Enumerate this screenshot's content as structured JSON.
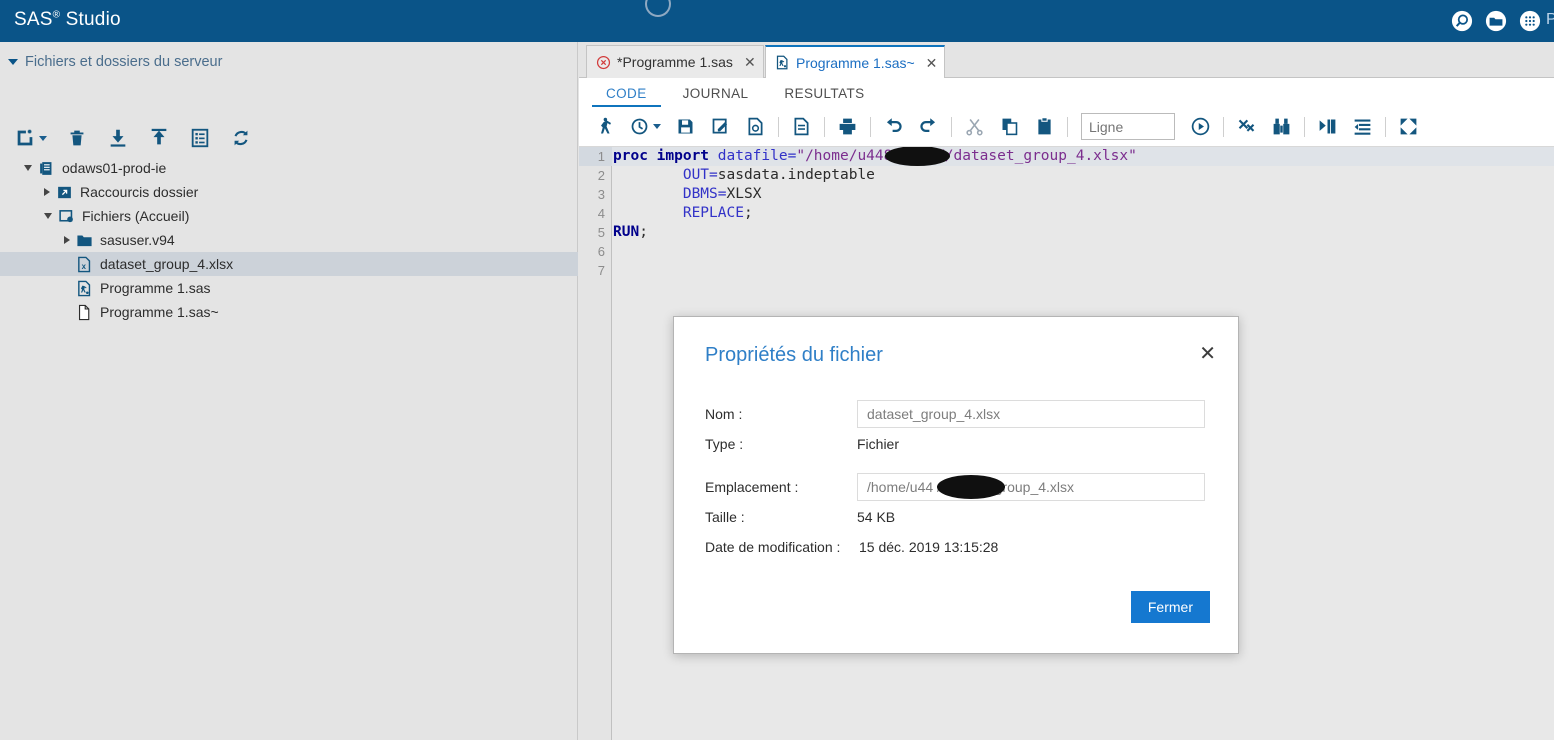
{
  "app": {
    "brand_name": "SAS",
    "brand_sup": "®",
    "brand_suffix": " Studio",
    "user_menu": "P",
    "header_icons": [
      "search-icon",
      "folder-icon",
      "apps-grid-icon"
    ],
    "accent_blue": "#0a5488",
    "link_blue": "#2f7fc7",
    "button_blue": "#1578d0"
  },
  "file_panel": {
    "title": "Fichiers et dossiers du serveur",
    "toolbar": [
      {
        "name": "new-file-button",
        "has_dropdown": true
      },
      {
        "name": "delete-button",
        "has_dropdown": false
      },
      {
        "name": "download-button",
        "has_dropdown": false
      },
      {
        "name": "upload-button",
        "has_dropdown": false
      },
      {
        "name": "properties-button",
        "has_dropdown": false
      },
      {
        "name": "refresh-button",
        "has_dropdown": false
      }
    ],
    "tree": [
      {
        "label": "odaws01-prod-ie",
        "indent": 0,
        "state": "open",
        "icon": "server-icon",
        "selected": false
      },
      {
        "label": "Raccourcis dossier",
        "indent": 1,
        "state": "closed",
        "icon": "shortcut-icon",
        "selected": false
      },
      {
        "label": "Fichiers (Accueil)",
        "indent": 1,
        "state": "open",
        "icon": "home-files-icon",
        "selected": false
      },
      {
        "label": "sasuser.v94",
        "indent": 2,
        "state": "closed",
        "icon": "folder-icon",
        "selected": false
      },
      {
        "label": "dataset_group_4.xlsx",
        "indent": 2,
        "state": "leaf",
        "icon": "excel-file-icon",
        "selected": true
      },
      {
        "label": "Programme 1.sas",
        "indent": 2,
        "state": "leaf",
        "icon": "sas-file-icon",
        "selected": false
      },
      {
        "label": "Programme 1.sas~",
        "indent": 2,
        "state": "leaf",
        "icon": "plain-file-icon",
        "selected": false
      }
    ]
  },
  "editor": {
    "tabs": [
      {
        "label": "*Programme 1.sas",
        "icon": "error-circle-icon",
        "active": false
      },
      {
        "label": "Programme 1.sas~",
        "icon": "sas-file-icon",
        "active": true
      }
    ],
    "subtabs": [
      {
        "label": "CODE",
        "active": true
      },
      {
        "label": "JOURNAL",
        "active": false
      },
      {
        "label": "RESULTATS",
        "active": false
      }
    ],
    "toolbar": [
      {
        "name": "run-button",
        "type": "icon"
      },
      {
        "name": "history-button",
        "type": "icon-dropdown"
      },
      {
        "name": "save-button",
        "type": "icon"
      },
      {
        "name": "save-as-button",
        "type": "icon"
      },
      {
        "name": "print-preview-button",
        "type": "icon"
      },
      {
        "name": "sep",
        "type": "sep"
      },
      {
        "name": "properties-button",
        "type": "icon"
      },
      {
        "name": "sep",
        "type": "sep"
      },
      {
        "name": "print-button",
        "type": "icon"
      },
      {
        "name": "sep",
        "type": "sep"
      },
      {
        "name": "undo-button",
        "type": "icon"
      },
      {
        "name": "redo-button",
        "type": "icon"
      },
      {
        "name": "sep",
        "type": "sep"
      },
      {
        "name": "cut-button",
        "type": "icon"
      },
      {
        "name": "copy-button",
        "type": "icon"
      },
      {
        "name": "paste-button",
        "type": "icon"
      },
      {
        "name": "sep",
        "type": "sep"
      },
      {
        "name": "line-input",
        "type": "input"
      },
      {
        "name": "goto-line-button",
        "type": "icon"
      },
      {
        "name": "sep",
        "type": "sep"
      },
      {
        "name": "clear-all-button",
        "type": "icon"
      },
      {
        "name": "find-replace-button",
        "type": "icon"
      },
      {
        "name": "sep",
        "type": "sep"
      },
      {
        "name": "indent-button",
        "type": "icon"
      },
      {
        "name": "outdent-button",
        "type": "icon"
      },
      {
        "name": "sep",
        "type": "sep"
      },
      {
        "name": "maximize-button",
        "type": "icon"
      }
    ],
    "line_placeholder": "Ligne",
    "line_value": "",
    "code_lines": [
      {
        "number": "1",
        "current": true,
        "tokens": [
          {
            "t": "proc import",
            "c": "kw"
          },
          {
            "t": " ",
            "c": "pln"
          },
          {
            "t": "datafile=",
            "c": "opt"
          },
          {
            "t": "\"/home/u448",
            "c": "str"
          },
          {
            "t": "XXXXXX",
            "c": "str"
          },
          {
            "t": "/dataset_group_4.xlsx\"",
            "c": "str"
          }
        ]
      },
      {
        "number": "2",
        "current": false,
        "tokens": [
          {
            "t": "        ",
            "c": "pln"
          },
          {
            "t": "OUT=",
            "c": "opt"
          },
          {
            "t": "sasdata.indeptable",
            "c": "pln"
          }
        ]
      },
      {
        "number": "3",
        "current": false,
        "tokens": [
          {
            "t": "        ",
            "c": "pln"
          },
          {
            "t": "DBMS=",
            "c": "opt"
          },
          {
            "t": "XLSX",
            "c": "pln"
          }
        ]
      },
      {
        "number": "4",
        "current": false,
        "tokens": [
          {
            "t": "        ",
            "c": "pln"
          },
          {
            "t": "REPLACE",
            "c": "opt"
          },
          {
            "t": ";",
            "c": "punc"
          }
        ]
      },
      {
        "number": "5",
        "current": false,
        "tokens": [
          {
            "t": "RUN",
            "c": "kw"
          },
          {
            "t": ";",
            "c": "punc"
          }
        ]
      },
      {
        "number": "6",
        "current": false,
        "tokens": []
      },
      {
        "number": "7",
        "current": false,
        "tokens": []
      }
    ]
  },
  "dialog": {
    "title": "Propriétés du fichier",
    "close_icon": "✕",
    "fields": [
      {
        "label": "Nom :",
        "value": "dataset_group_4.xlsx",
        "boxed": true,
        "redacted": false
      },
      {
        "label": "Type :",
        "value": "Fichier",
        "boxed": false,
        "redacted": false
      },
      {
        "label": "Emplacement :",
        "value": "/home/u44XXXXX/dataset_group_4.xlsx",
        "boxed": true,
        "redacted": true
      },
      {
        "label": "Taille :",
        "value": "54 KB",
        "boxed": false,
        "redacted": false
      },
      {
        "label": "Date de modification :",
        "value": "15 déc. 2019 13:15:28",
        "boxed": false,
        "redacted": false,
        "inline": true
      }
    ],
    "close_button": "Fermer"
  }
}
